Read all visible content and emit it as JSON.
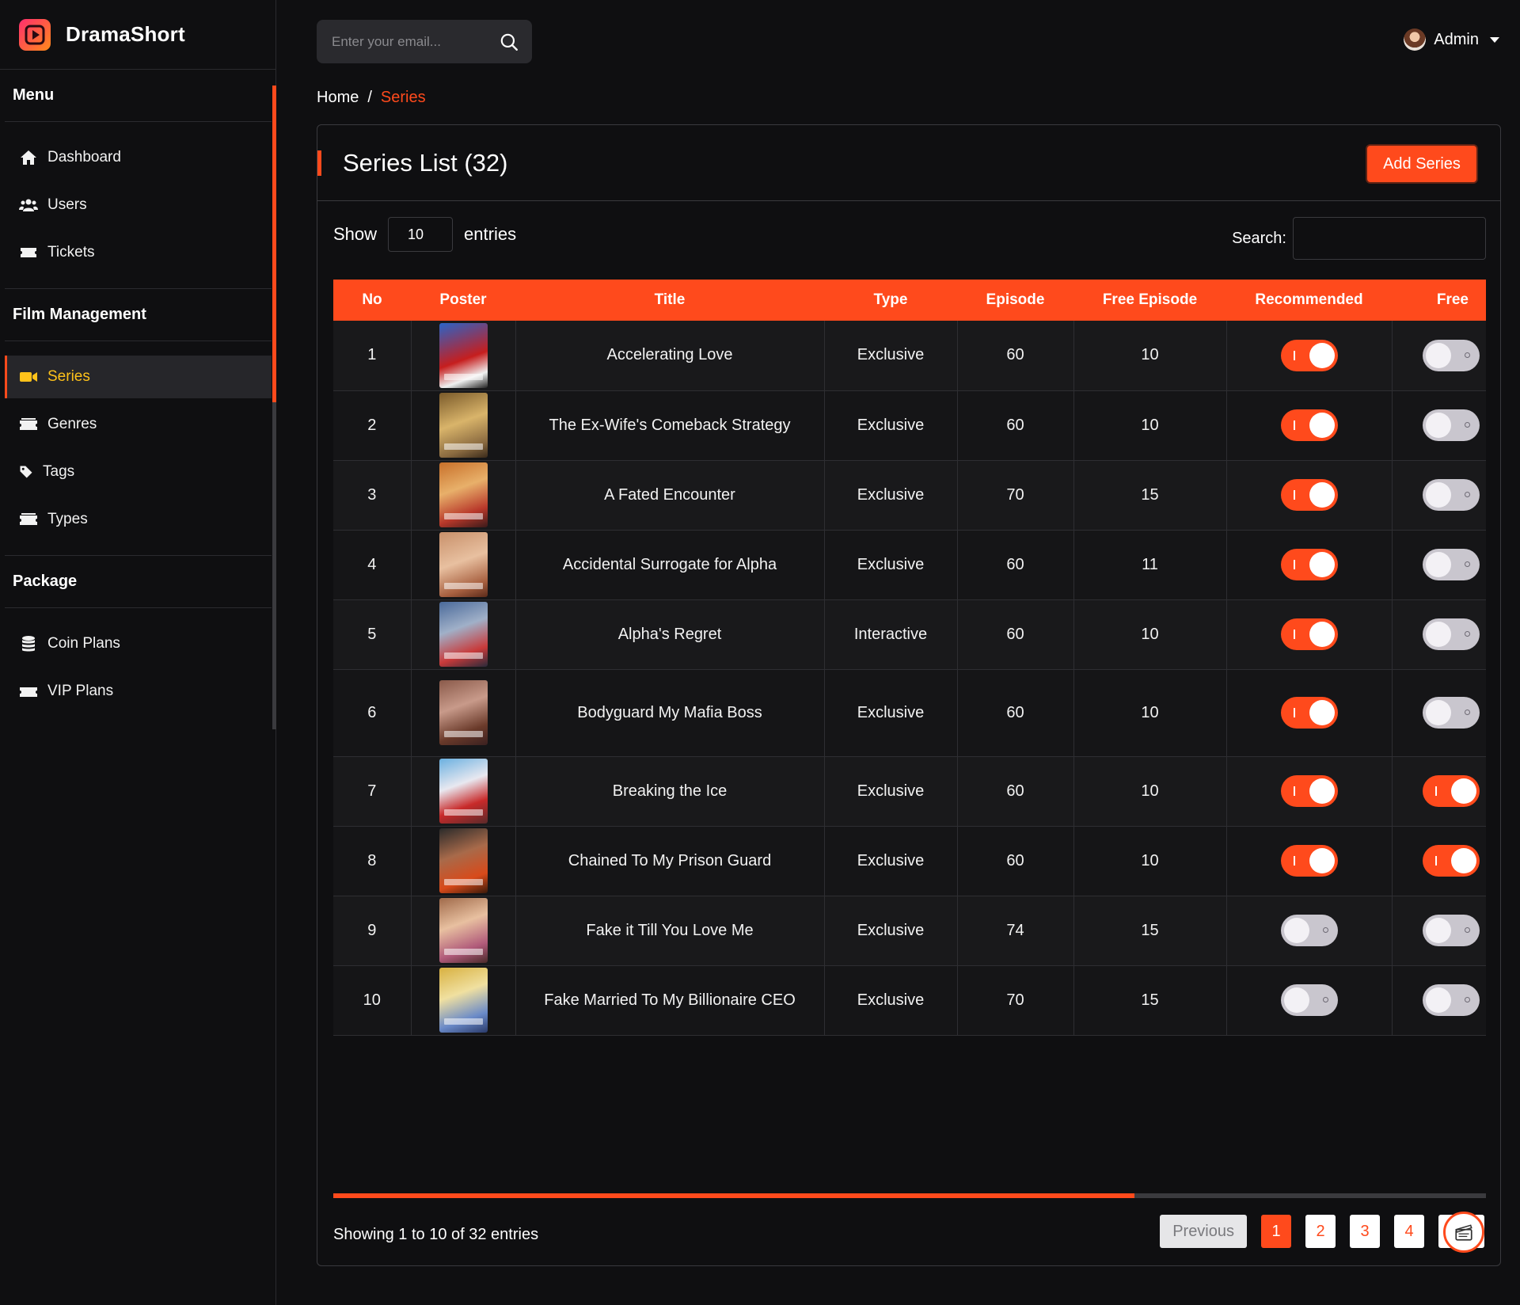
{
  "brand": {
    "name": "DramaShort"
  },
  "sidebar": {
    "sections": [
      {
        "title": "Menu",
        "items": [
          {
            "label": "Dashboard",
            "icon": "home-icon"
          },
          {
            "label": "Users",
            "icon": "users-icon"
          },
          {
            "label": "Tickets",
            "icon": "ticket-icon"
          }
        ]
      },
      {
        "title": "Film Management",
        "items": [
          {
            "label": "Series",
            "icon": "video-icon",
            "active": true
          },
          {
            "label": "Genres",
            "icon": "genres-icon"
          },
          {
            "label": "Tags",
            "icon": "tag-icon"
          },
          {
            "label": "Types",
            "icon": "types-icon"
          }
        ]
      },
      {
        "title": "Package",
        "items": [
          {
            "label": "Coin Plans",
            "icon": "coins-icon"
          },
          {
            "label": "VIP Plans",
            "icon": "vip-icon"
          }
        ]
      }
    ]
  },
  "topbar": {
    "search_placeholder": "Enter your email...",
    "user_name": "Admin"
  },
  "breadcrumb": {
    "home": "Home",
    "sep": "/",
    "current": "Series"
  },
  "card": {
    "title": "Series List (32)",
    "add_label": "Add Series"
  },
  "controls": {
    "show_label": "Show",
    "entries_value": "10",
    "entries_label": "entries",
    "search_label": "Search:"
  },
  "table": {
    "columns": [
      "No",
      "Poster",
      "Title",
      "Type",
      "Episode",
      "Free Episode",
      "Recommended",
      "Free"
    ],
    "rows": [
      {
        "no": "1",
        "title": "Accelerating Love",
        "type": "Exclusive",
        "episode": "60",
        "free_episode": "10",
        "recommended": true,
        "free": false
      },
      {
        "no": "2",
        "title": "The Ex-Wife's Comeback Strategy",
        "type": "Exclusive",
        "episode": "60",
        "free_episode": "10",
        "recommended": true,
        "free": false
      },
      {
        "no": "3",
        "title": "A Fated Encounter",
        "type": "Exclusive",
        "episode": "70",
        "free_episode": "15",
        "recommended": true,
        "free": false
      },
      {
        "no": "4",
        "title": "Accidental Surrogate for Alpha",
        "type": "Exclusive",
        "episode": "60",
        "free_episode": "11",
        "recommended": true,
        "free": false
      },
      {
        "no": "5",
        "title": "Alpha's Regret",
        "type": "Interactive",
        "episode": "60",
        "free_episode": "10",
        "recommended": true,
        "free": false
      },
      {
        "no": "6",
        "title": "Bodyguard My Mafia Boss",
        "type": "Exclusive",
        "episode": "60",
        "free_episode": "10",
        "recommended": true,
        "free": false
      },
      {
        "no": "7",
        "title": "Breaking the Ice",
        "type": "Exclusive",
        "episode": "60",
        "free_episode": "10",
        "recommended": true,
        "free": true
      },
      {
        "no": "8",
        "title": "Chained To My Prison Guard",
        "type": "Exclusive",
        "episode": "60",
        "free_episode": "10",
        "recommended": true,
        "free": true
      },
      {
        "no": "9",
        "title": "Fake it Till You Love Me",
        "type": "Exclusive",
        "episode": "74",
        "free_episode": "15",
        "recommended": false,
        "free": false
      },
      {
        "no": "10",
        "title": "Fake Married To My Billionaire CEO",
        "type": "Exclusive",
        "episode": "70",
        "free_episode": "15",
        "recommended": false,
        "free": false
      }
    ]
  },
  "footer": {
    "info": "Showing 1 to 10 of 32 entries"
  },
  "pagination": {
    "prev": "Previous",
    "pages": [
      "1",
      "2",
      "3",
      "4"
    ],
    "active": "1",
    "next": "N"
  },
  "colors": {
    "accent": "#ff4a1c",
    "active_nav": "#ffc21a",
    "background": "#0f0f11"
  }
}
